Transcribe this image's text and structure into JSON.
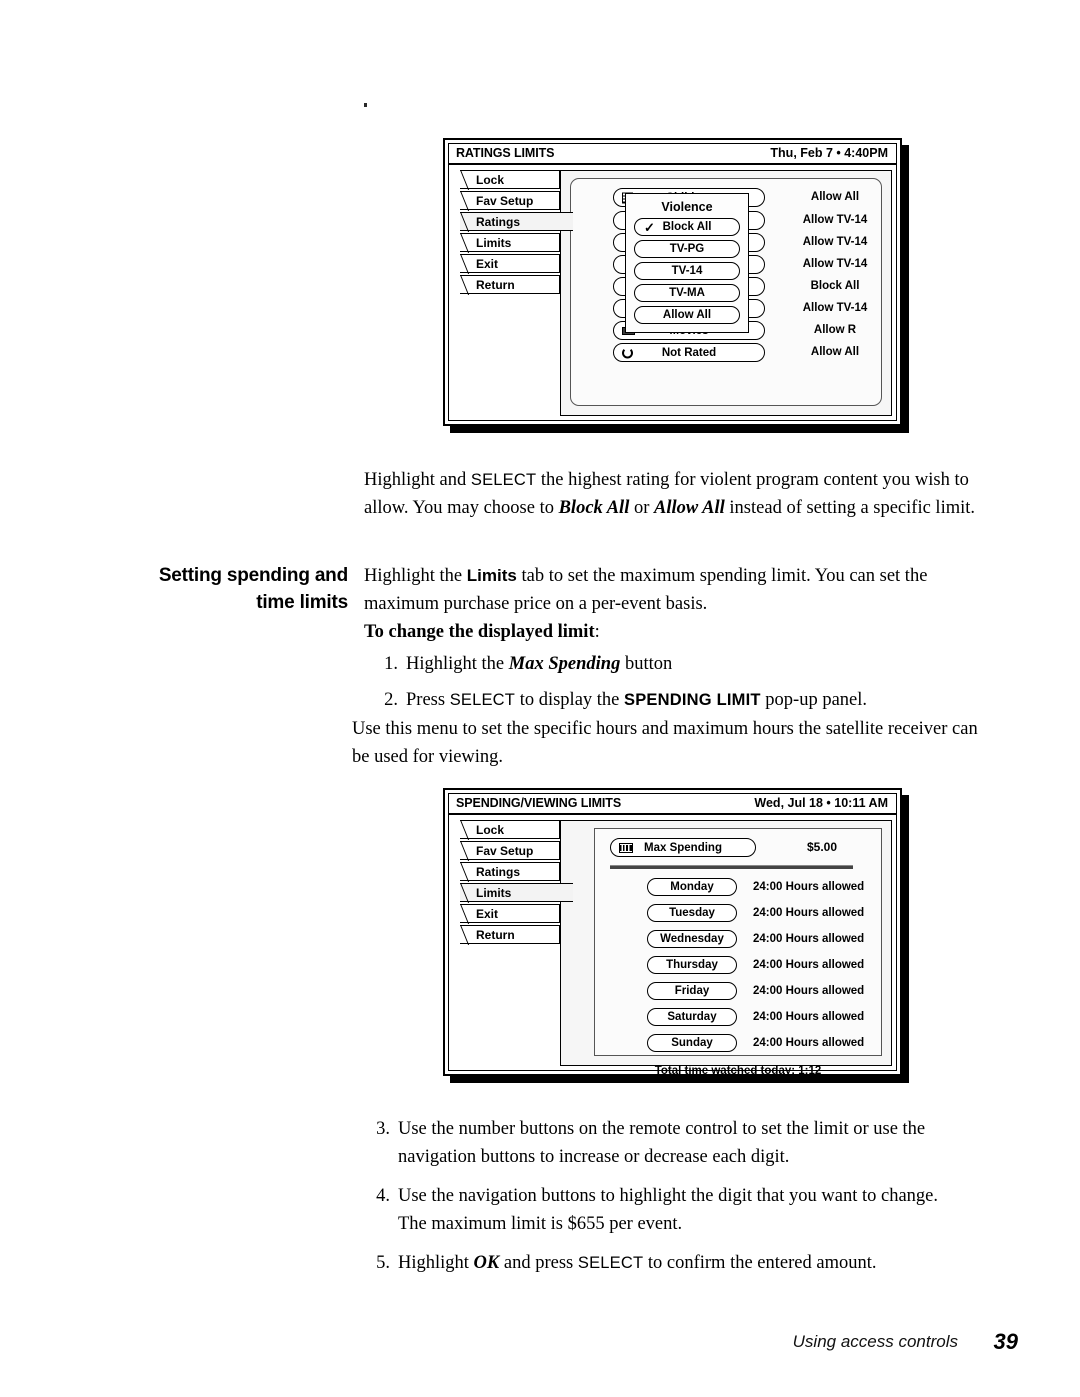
{
  "page": {
    "number": "39",
    "footer_label": "Using access controls"
  },
  "screens": {
    "ratings": {
      "title": "RATINGS LIMITS",
      "clock": "Thu, Feb 7 •  4:40PM",
      "tabs": [
        {
          "label": "Lock",
          "selected": false
        },
        {
          "label": "Fav Setup",
          "selected": false
        },
        {
          "label": "Ratings",
          "selected": true
        },
        {
          "label": "Limits",
          "selected": false
        },
        {
          "label": "Exit",
          "selected": false
        },
        {
          "label": "Return",
          "selected": false
        }
      ],
      "rows": [
        {
          "label": "Children",
          "icon": "list-icon",
          "value": "Allow All"
        },
        {
          "label": "",
          "icon": "",
          "value": "Allow TV-14"
        },
        {
          "label": "",
          "icon": "",
          "value": "Allow TV-14"
        },
        {
          "label": "",
          "icon": "",
          "value": "Allow TV-14"
        },
        {
          "label": "",
          "icon": "",
          "value": "Block All"
        },
        {
          "label": "",
          "icon": "",
          "value": "Allow TV-14"
        },
        {
          "label": "Movies",
          "icon": "film-icon",
          "value": "Allow R"
        },
        {
          "label": "Not Rated",
          "icon": "refresh-icon",
          "value": "Allow All"
        }
      ],
      "popup": {
        "title": "Violence",
        "options": [
          {
            "label": "Block All",
            "checked": true
          },
          {
            "label": "TV-PG",
            "checked": false
          },
          {
            "label": "TV-14",
            "checked": false
          },
          {
            "label": "TV-MA",
            "checked": false
          },
          {
            "label": "Allow All",
            "checked": false
          }
        ],
        "check_glyph": "✓"
      }
    },
    "spending": {
      "title": "SPENDING/VIEWING LIMITS",
      "clock": "Wed, Jul 18 •  10:11 AM",
      "tabs": [
        {
          "label": "Lock",
          "selected": false
        },
        {
          "label": "Fav Setup",
          "selected": false
        },
        {
          "label": "Ratings",
          "selected": false
        },
        {
          "label": "Limits",
          "selected": true
        },
        {
          "label": "Exit",
          "selected": false
        },
        {
          "label": "Return",
          "selected": false
        }
      ],
      "max_spending": {
        "label": "Max Spending",
        "icon": "bars-icon",
        "value": "$5.00"
      },
      "days": [
        {
          "label": "Monday",
          "value": "24:00 Hours allowed"
        },
        {
          "label": "Tuesday",
          "value": "24:00 Hours allowed"
        },
        {
          "label": "Wednesday",
          "value": "24:00 Hours allowed"
        },
        {
          "label": "Thursday",
          "value": "24:00 Hours allowed"
        },
        {
          "label": "Friday",
          "value": "24:00 Hours allowed"
        },
        {
          "label": "Saturday",
          "value": "24:00 Hours allowed"
        },
        {
          "label": "Sunday",
          "value": "24:00 Hours allowed"
        }
      ],
      "total": "Total time watched today:  1:12"
    }
  },
  "body": {
    "para1_a": "Highlight and ",
    "para1_sc": "SELECT",
    "para1_b": " the highest rating for violent program content you wish to allow. You may choose to ",
    "para1_i1": "Block All",
    "para1_c": " or ",
    "para1_i2": "Allow All",
    "para1_d": " instead of setting a specific limit.",
    "side_head_line1": "Setting spending and",
    "side_head_line2": "time limits",
    "para2_a": "Highlight the ",
    "para2_b": "Limits",
    "para2_c": " tab to set the maximum spending limit. You can set the maximum purchase price on a per-event basis.",
    "sub_head": "To change the displayed limit",
    "sub_head_colon": ":",
    "step1_a": "Highlight the ",
    "step1_i": "Max Spending",
    "step1_b": " button",
    "step2_a": "Press ",
    "step2_sc": "SELECT",
    "step2_b": " to display the ",
    "step2_bold": "SPENDING LIMIT",
    "step2_c": " pop-up panel.",
    "para3": "Use this menu to set the specific hours and maximum hours the satellite receiver can be used for viewing.",
    "step3": "Use the number buttons on the remote control to set the limit or use the navigation buttons to increase or decrease each digit.",
    "step4": "Use the navigation buttons to highlight the digit that you want to change. The maximum limit is $655 per event.",
    "step5_a": "Highlight ",
    "step5_i": "OK",
    "step5_b": " and press ",
    "step5_sc": "SELECT",
    "step5_c": " to confirm the entered amount.",
    "num1": "1.",
    "num2": "2.",
    "num3": "3.",
    "num4": "4.",
    "num5": "5."
  }
}
